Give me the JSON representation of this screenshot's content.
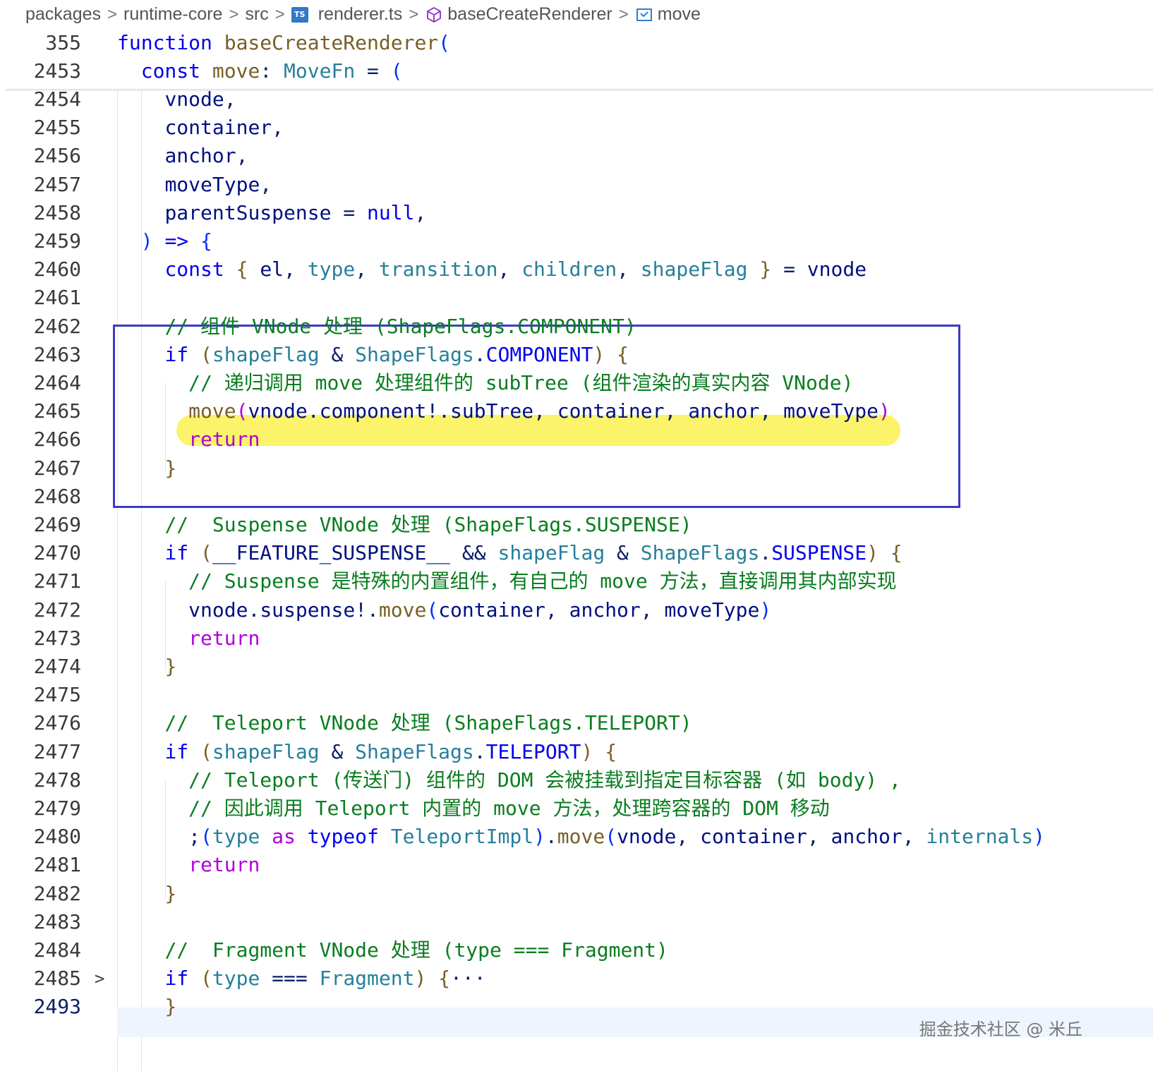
{
  "breadcrumb": {
    "items": [
      "packages",
      "runtime-core",
      "src",
      "renderer.ts",
      "baseCreateRenderer",
      "move"
    ],
    "file_icon": "TS"
  },
  "code": {
    "sticky": [
      {
        "n": "355",
        "tokens": [
          [
            "kw",
            "function"
          ],
          [
            "pm",
            " "
          ],
          [
            "fn",
            "baseCreateRenderer"
          ],
          [
            "bb",
            "("
          ]
        ]
      },
      {
        "n": "2453",
        "tokens": [
          [
            "pm",
            "  "
          ],
          [
            "kw",
            "const"
          ],
          [
            "pm",
            " "
          ],
          [
            "fn",
            "move"
          ],
          [
            "pm",
            ": "
          ],
          [
            "ty",
            "MoveFn"
          ],
          [
            "pm",
            " = "
          ],
          [
            "bb",
            "("
          ]
        ]
      }
    ],
    "lines": [
      {
        "n": "2454",
        "tokens": [
          [
            "pm",
            "    "
          ],
          [
            "vr",
            "vnode"
          ],
          [
            "pm",
            ","
          ]
        ]
      },
      {
        "n": "2455",
        "tokens": [
          [
            "pm",
            "    "
          ],
          [
            "vr",
            "container"
          ],
          [
            "pm",
            ","
          ]
        ]
      },
      {
        "n": "2456",
        "tokens": [
          [
            "pm",
            "    "
          ],
          [
            "vr",
            "anchor"
          ],
          [
            "pm",
            ","
          ]
        ]
      },
      {
        "n": "2457",
        "tokens": [
          [
            "pm",
            "    "
          ],
          [
            "vr",
            "moveType"
          ],
          [
            "pm",
            ","
          ]
        ]
      },
      {
        "n": "2458",
        "tokens": [
          [
            "pm",
            "    "
          ],
          [
            "vr",
            "parentSuspense"
          ],
          [
            "pm",
            " = "
          ],
          [
            "kw",
            "null"
          ],
          [
            "pm",
            ","
          ]
        ]
      },
      {
        "n": "2459",
        "tokens": [
          [
            "pm",
            "  "
          ],
          [
            "bb",
            ")"
          ],
          [
            "pm",
            " "
          ],
          [
            "kw",
            "=>"
          ],
          [
            "pm",
            " "
          ],
          [
            "bb",
            "{"
          ]
        ]
      },
      {
        "n": "2460",
        "tokens": [
          [
            "pm",
            "    "
          ],
          [
            "kw",
            "const"
          ],
          [
            "pm",
            " "
          ],
          [
            "br",
            "{"
          ],
          [
            "pm",
            " "
          ],
          [
            "vr",
            "el"
          ],
          [
            "pm",
            ", "
          ],
          [
            "ty",
            "type"
          ],
          [
            "pm",
            ", "
          ],
          [
            "ty",
            "transition"
          ],
          [
            "pm",
            ", "
          ],
          [
            "ty",
            "children"
          ],
          [
            "pm",
            ", "
          ],
          [
            "ty",
            "shapeFlag"
          ],
          [
            "pm",
            " "
          ],
          [
            "br",
            "}"
          ],
          [
            "pm",
            " = "
          ],
          [
            "vr",
            "vnode"
          ]
        ]
      },
      {
        "n": "2461",
        "tokens": []
      },
      {
        "n": "2462",
        "tokens": [
          [
            "pm",
            "    "
          ],
          [
            "cm",
            "// 组件 VNode 处理 (ShapeFlags.COMPONENT)"
          ]
        ]
      },
      {
        "n": "2463",
        "tokens": [
          [
            "pm",
            "    "
          ],
          [
            "kw",
            "if"
          ],
          [
            "pm",
            " "
          ],
          [
            "br",
            "("
          ],
          [
            "ty",
            "shapeFlag"
          ],
          [
            "pm",
            " & "
          ],
          [
            "ty",
            "ShapeFlags"
          ],
          [
            "pm",
            "."
          ],
          [
            "kw",
            "COMPONENT"
          ],
          [
            "br",
            ")"
          ],
          [
            "pm",
            " "
          ],
          [
            "br",
            "{"
          ]
        ]
      },
      {
        "n": "2464",
        "tokens": [
          [
            "pm",
            "      "
          ],
          [
            "cm",
            "// 递归调用 move 处理组件的 subTree (组件渲染的真实内容 VNode)"
          ]
        ]
      },
      {
        "n": "2465",
        "tokens": [
          [
            "pm",
            "      "
          ],
          [
            "fn",
            "move"
          ],
          [
            "kw2",
            "("
          ],
          [
            "vr",
            "vnode"
          ],
          [
            "pm",
            "."
          ],
          [
            "vr",
            "component"
          ],
          [
            "pm",
            "!."
          ],
          [
            "vr",
            "subTree"
          ],
          [
            "pm",
            ", "
          ],
          [
            "vr",
            "container"
          ],
          [
            "pm",
            ", "
          ],
          [
            "vr",
            "anchor"
          ],
          [
            "pm",
            ", "
          ],
          [
            "vr",
            "moveType"
          ],
          [
            "kw2",
            ")"
          ]
        ]
      },
      {
        "n": "2466",
        "tokens": [
          [
            "pm",
            "      "
          ],
          [
            "kw2",
            "return"
          ]
        ]
      },
      {
        "n": "2467",
        "tokens": [
          [
            "pm",
            "    "
          ],
          [
            "br",
            "}"
          ]
        ]
      },
      {
        "n": "2468",
        "tokens": []
      },
      {
        "n": "2469",
        "tokens": [
          [
            "pm",
            "    "
          ],
          [
            "cm",
            "//  Suspense VNode 处理 (ShapeFlags.SUSPENSE)"
          ]
        ]
      },
      {
        "n": "2470",
        "tokens": [
          [
            "pm",
            "    "
          ],
          [
            "kw",
            "if"
          ],
          [
            "pm",
            " "
          ],
          [
            "br",
            "("
          ],
          [
            "vr",
            "__FEATURE_SUSPENSE__"
          ],
          [
            "pm",
            " && "
          ],
          [
            "ty",
            "shapeFlag"
          ],
          [
            "pm",
            " & "
          ],
          [
            "ty",
            "ShapeFlags"
          ],
          [
            "pm",
            "."
          ],
          [
            "kw",
            "SUSPENSE"
          ],
          [
            "br",
            ")"
          ],
          [
            "pm",
            " "
          ],
          [
            "br",
            "{"
          ]
        ]
      },
      {
        "n": "2471",
        "tokens": [
          [
            "pm",
            "      "
          ],
          [
            "cm",
            "// Suspense 是特殊的内置组件，有自己的 move 方法，直接调用其内部实现"
          ]
        ]
      },
      {
        "n": "2472",
        "tokens": [
          [
            "pm",
            "      "
          ],
          [
            "vr",
            "vnode"
          ],
          [
            "pm",
            "."
          ],
          [
            "vr",
            "suspense"
          ],
          [
            "pm",
            "!."
          ],
          [
            "fn",
            "move"
          ],
          [
            "bb",
            "("
          ],
          [
            "vr",
            "container"
          ],
          [
            "pm",
            ", "
          ],
          [
            "vr",
            "anchor"
          ],
          [
            "pm",
            ", "
          ],
          [
            "vr",
            "moveType"
          ],
          [
            "bb",
            ")"
          ]
        ]
      },
      {
        "n": "2473",
        "tokens": [
          [
            "pm",
            "      "
          ],
          [
            "kw2",
            "return"
          ]
        ]
      },
      {
        "n": "2474",
        "tokens": [
          [
            "pm",
            "    "
          ],
          [
            "br",
            "}"
          ]
        ]
      },
      {
        "n": "2475",
        "tokens": []
      },
      {
        "n": "2476",
        "tokens": [
          [
            "pm",
            "    "
          ],
          [
            "cm",
            "//  Teleport VNode 处理 (ShapeFlags.TELEPORT)"
          ]
        ]
      },
      {
        "n": "2477",
        "tokens": [
          [
            "pm",
            "    "
          ],
          [
            "kw",
            "if"
          ],
          [
            "pm",
            " "
          ],
          [
            "br",
            "("
          ],
          [
            "ty",
            "shapeFlag"
          ],
          [
            "pm",
            " & "
          ],
          [
            "ty",
            "ShapeFlags"
          ],
          [
            "pm",
            "."
          ],
          [
            "kw",
            "TELEPORT"
          ],
          [
            "br",
            ")"
          ],
          [
            "pm",
            " "
          ],
          [
            "br",
            "{"
          ]
        ]
      },
      {
        "n": "2478",
        "tokens": [
          [
            "pm",
            "      "
          ],
          [
            "cm",
            "// Teleport (传送门) 组件的 DOM 会被挂载到指定目标容器 (如 body) ,"
          ]
        ]
      },
      {
        "n": "2479",
        "tokens": [
          [
            "pm",
            "      "
          ],
          [
            "cm",
            "// 因此调用 Teleport 内置的 move 方法，处理跨容器的 DOM 移动"
          ]
        ]
      },
      {
        "n": "2480",
        "tokens": [
          [
            "pm",
            "      ;"
          ],
          [
            "bb",
            "("
          ],
          [
            "ty",
            "type"
          ],
          [
            "pm",
            " "
          ],
          [
            "kw2",
            "as"
          ],
          [
            "pm",
            " "
          ],
          [
            "kw",
            "typeof"
          ],
          [
            "pm",
            " "
          ],
          [
            "ty",
            "TeleportImpl"
          ],
          [
            "bb",
            ")"
          ],
          [
            "pm",
            "."
          ],
          [
            "fn",
            "move"
          ],
          [
            "bb",
            "("
          ],
          [
            "vr",
            "vnode"
          ],
          [
            "pm",
            ", "
          ],
          [
            "vr",
            "container"
          ],
          [
            "pm",
            ", "
          ],
          [
            "vr",
            "anchor"
          ],
          [
            "pm",
            ", "
          ],
          [
            "ty",
            "internals"
          ],
          [
            "bb",
            ")"
          ]
        ]
      },
      {
        "n": "2481",
        "tokens": [
          [
            "pm",
            "      "
          ],
          [
            "kw2",
            "return"
          ]
        ]
      },
      {
        "n": "2482",
        "tokens": [
          [
            "pm",
            "    "
          ],
          [
            "br",
            "}"
          ]
        ]
      },
      {
        "n": "2483",
        "tokens": []
      },
      {
        "n": "2484",
        "tokens": [
          [
            "pm",
            "    "
          ],
          [
            "cm",
            "//  Fragment VNode 处理 (type === Fragment)"
          ]
        ]
      },
      {
        "n": "2485",
        "tokens": [
          [
            "pm",
            "    "
          ],
          [
            "kw",
            "if"
          ],
          [
            "pm",
            " "
          ],
          [
            "br",
            "("
          ],
          [
            "ty",
            "type"
          ],
          [
            "pm",
            " === "
          ],
          [
            "ty",
            "Fragment"
          ],
          [
            "br",
            ")"
          ],
          [
            "pm",
            " "
          ],
          [
            "br",
            "{"
          ],
          [
            "pm",
            "···"
          ]
        ]
      },
      {
        "n": "2493",
        "tokens": [
          [
            "pm",
            "    "
          ],
          [
            "br",
            "}"
          ]
        ]
      }
    ]
  },
  "watermark": "掘金技术社区 @ 米丘",
  "colors": {
    "highlight": "#fbf36a",
    "box": "#3a3bc6",
    "keyword": "#0000ee",
    "comment": "#0a7d20"
  }
}
